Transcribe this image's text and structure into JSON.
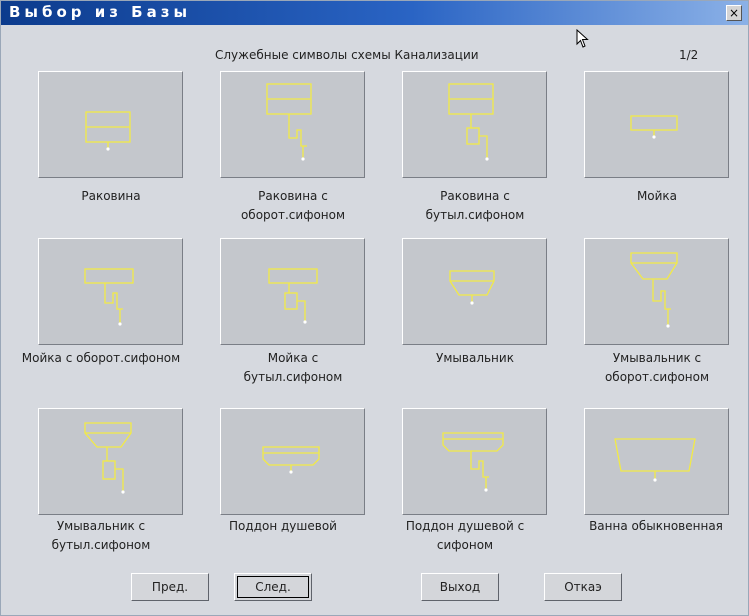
{
  "window": {
    "title": "Выбор из Базы",
    "close_label": "×"
  },
  "header": {
    "label": "Служебные символы схемы Канализации",
    "page": "1/2"
  },
  "tiles": [
    {
      "caption": "Раковина",
      "symbol": "sink-symbol-icon"
    },
    {
      "caption": "Раковина с оборот.сифоном",
      "symbol": "sink-with-trap-symbol-icon"
    },
    {
      "caption": "Раковина с бутыл.сифоном",
      "symbol": "sink-with-bottle-trap-symbol-icon"
    },
    {
      "caption": "Мойка",
      "symbol": "kitchen-sink-symbol-icon"
    },
    {
      "caption": "Мойка с оборот.сифоном",
      "symbol": "kitchen-sink-with-trap-symbol-icon"
    },
    {
      "caption": "Мойка с бутыл.сифоном",
      "symbol": "kitchen-sink-with-bottle-trap-symbol-icon"
    },
    {
      "caption": "Умывальник",
      "symbol": "washbasin-symbol-icon"
    },
    {
      "caption": "Умывальник с оборот.сифоном",
      "symbol": "washbasin-with-trap-symbol-icon"
    },
    {
      "caption": "Умывальник с бутыл.сифоном",
      "symbol": "washbasin-with-bottle-trap-symbol-icon"
    },
    {
      "caption": "Поддон душевой",
      "symbol": "shower-tray-symbol-icon"
    },
    {
      "caption": "Поддон душевой с сифоном",
      "symbol": "shower-tray-with-trap-symbol-icon"
    },
    {
      "caption": "Ванна обыкновенная",
      "symbol": "bathtub-symbol-icon"
    }
  ],
  "buttons": {
    "prev": "Пред.",
    "next": "След.",
    "exit": "Выход",
    "cancel": "Откаэ"
  },
  "colors": {
    "symbol_stroke": "#f2ea46",
    "title_bar": "#1246a0"
  }
}
